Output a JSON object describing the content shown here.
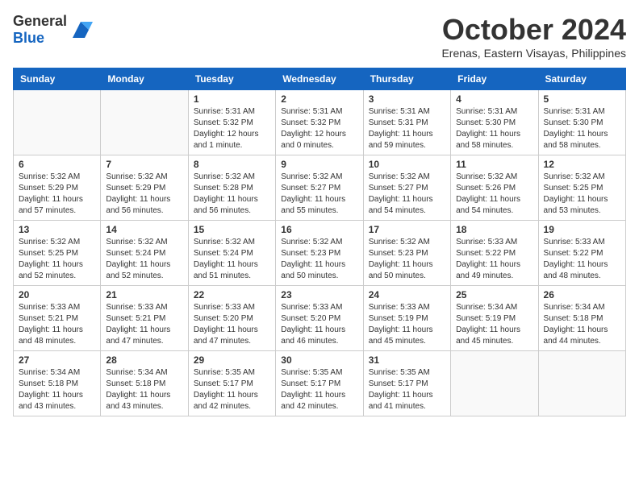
{
  "header": {
    "logo_general": "General",
    "logo_blue": "Blue",
    "month_title": "October 2024",
    "location": "Erenas, Eastern Visayas, Philippines"
  },
  "weekdays": [
    "Sunday",
    "Monday",
    "Tuesday",
    "Wednesday",
    "Thursday",
    "Friday",
    "Saturday"
  ],
  "weeks": [
    [
      {
        "day": "",
        "info": ""
      },
      {
        "day": "",
        "info": ""
      },
      {
        "day": "1",
        "info": "Sunrise: 5:31 AM\nSunset: 5:32 PM\nDaylight: 12 hours\nand 1 minute."
      },
      {
        "day": "2",
        "info": "Sunrise: 5:31 AM\nSunset: 5:32 PM\nDaylight: 12 hours\nand 0 minutes."
      },
      {
        "day": "3",
        "info": "Sunrise: 5:31 AM\nSunset: 5:31 PM\nDaylight: 11 hours\nand 59 minutes."
      },
      {
        "day": "4",
        "info": "Sunrise: 5:31 AM\nSunset: 5:30 PM\nDaylight: 11 hours\nand 58 minutes."
      },
      {
        "day": "5",
        "info": "Sunrise: 5:31 AM\nSunset: 5:30 PM\nDaylight: 11 hours\nand 58 minutes."
      }
    ],
    [
      {
        "day": "6",
        "info": "Sunrise: 5:32 AM\nSunset: 5:29 PM\nDaylight: 11 hours\nand 57 minutes."
      },
      {
        "day": "7",
        "info": "Sunrise: 5:32 AM\nSunset: 5:29 PM\nDaylight: 11 hours\nand 56 minutes."
      },
      {
        "day": "8",
        "info": "Sunrise: 5:32 AM\nSunset: 5:28 PM\nDaylight: 11 hours\nand 56 minutes."
      },
      {
        "day": "9",
        "info": "Sunrise: 5:32 AM\nSunset: 5:27 PM\nDaylight: 11 hours\nand 55 minutes."
      },
      {
        "day": "10",
        "info": "Sunrise: 5:32 AM\nSunset: 5:27 PM\nDaylight: 11 hours\nand 54 minutes."
      },
      {
        "day": "11",
        "info": "Sunrise: 5:32 AM\nSunset: 5:26 PM\nDaylight: 11 hours\nand 54 minutes."
      },
      {
        "day": "12",
        "info": "Sunrise: 5:32 AM\nSunset: 5:25 PM\nDaylight: 11 hours\nand 53 minutes."
      }
    ],
    [
      {
        "day": "13",
        "info": "Sunrise: 5:32 AM\nSunset: 5:25 PM\nDaylight: 11 hours\nand 52 minutes."
      },
      {
        "day": "14",
        "info": "Sunrise: 5:32 AM\nSunset: 5:24 PM\nDaylight: 11 hours\nand 52 minutes."
      },
      {
        "day": "15",
        "info": "Sunrise: 5:32 AM\nSunset: 5:24 PM\nDaylight: 11 hours\nand 51 minutes."
      },
      {
        "day": "16",
        "info": "Sunrise: 5:32 AM\nSunset: 5:23 PM\nDaylight: 11 hours\nand 50 minutes."
      },
      {
        "day": "17",
        "info": "Sunrise: 5:32 AM\nSunset: 5:23 PM\nDaylight: 11 hours\nand 50 minutes."
      },
      {
        "day": "18",
        "info": "Sunrise: 5:33 AM\nSunset: 5:22 PM\nDaylight: 11 hours\nand 49 minutes."
      },
      {
        "day": "19",
        "info": "Sunrise: 5:33 AM\nSunset: 5:22 PM\nDaylight: 11 hours\nand 48 minutes."
      }
    ],
    [
      {
        "day": "20",
        "info": "Sunrise: 5:33 AM\nSunset: 5:21 PM\nDaylight: 11 hours\nand 48 minutes."
      },
      {
        "day": "21",
        "info": "Sunrise: 5:33 AM\nSunset: 5:21 PM\nDaylight: 11 hours\nand 47 minutes."
      },
      {
        "day": "22",
        "info": "Sunrise: 5:33 AM\nSunset: 5:20 PM\nDaylight: 11 hours\nand 47 minutes."
      },
      {
        "day": "23",
        "info": "Sunrise: 5:33 AM\nSunset: 5:20 PM\nDaylight: 11 hours\nand 46 minutes."
      },
      {
        "day": "24",
        "info": "Sunrise: 5:33 AM\nSunset: 5:19 PM\nDaylight: 11 hours\nand 45 minutes."
      },
      {
        "day": "25",
        "info": "Sunrise: 5:34 AM\nSunset: 5:19 PM\nDaylight: 11 hours\nand 45 minutes."
      },
      {
        "day": "26",
        "info": "Sunrise: 5:34 AM\nSunset: 5:18 PM\nDaylight: 11 hours\nand 44 minutes."
      }
    ],
    [
      {
        "day": "27",
        "info": "Sunrise: 5:34 AM\nSunset: 5:18 PM\nDaylight: 11 hours\nand 43 minutes."
      },
      {
        "day": "28",
        "info": "Sunrise: 5:34 AM\nSunset: 5:18 PM\nDaylight: 11 hours\nand 43 minutes."
      },
      {
        "day": "29",
        "info": "Sunrise: 5:35 AM\nSunset: 5:17 PM\nDaylight: 11 hours\nand 42 minutes."
      },
      {
        "day": "30",
        "info": "Sunrise: 5:35 AM\nSunset: 5:17 PM\nDaylight: 11 hours\nand 42 minutes."
      },
      {
        "day": "31",
        "info": "Sunrise: 5:35 AM\nSunset: 5:17 PM\nDaylight: 11 hours\nand 41 minutes."
      },
      {
        "day": "",
        "info": ""
      },
      {
        "day": "",
        "info": ""
      }
    ]
  ]
}
